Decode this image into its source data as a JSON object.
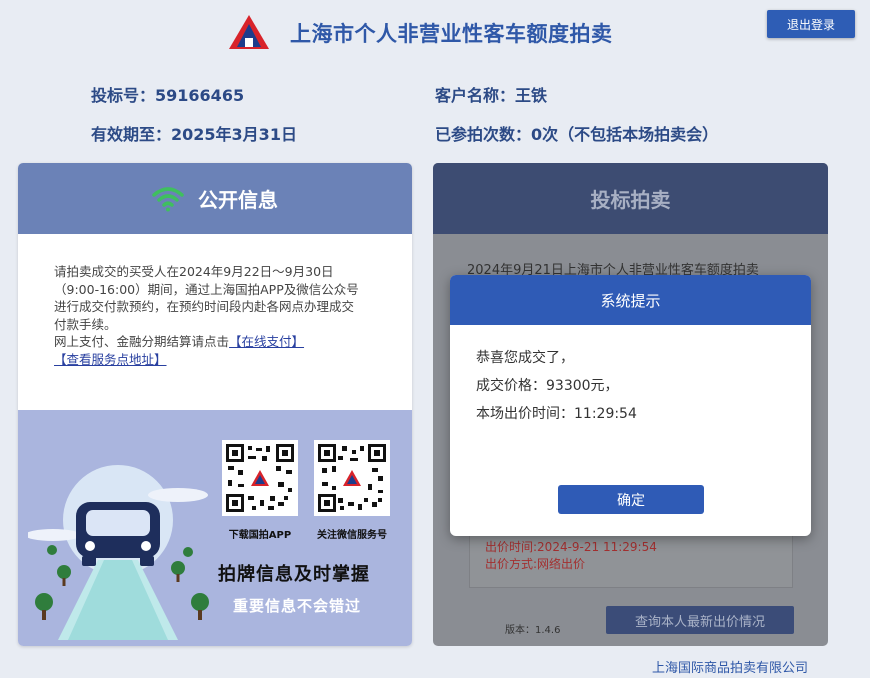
{
  "header": {
    "title": "上海市个人非营业性客车额度拍卖",
    "logout_label": "退出登录",
    "logo_icon": "auction-logo-triangle"
  },
  "user_info": {
    "bid_number_label": "投标号：",
    "bid_number": "59166465",
    "customer_name_label": "客户名称：",
    "customer_name": "王铁",
    "valid_until_label": "有效期至：",
    "valid_until": "2025年3月31日",
    "participated_label": "已参拍次数：",
    "participated": "0次（不包括本场拍卖会）"
  },
  "public_info": {
    "title": "公开信息",
    "icon": "wifi-icon",
    "notice_lines": [
      "请拍卖成交的买受人在2024年9月22日～9月30日",
      "（9:00-16:00）期间，通过上海国拍APP及微信公众号",
      "进行成交付款预约，在预约时间段内赴各网点办理成交",
      "付款手续。"
    ],
    "online_pay_prefix": "网上支付、金融分期结算请点击",
    "online_pay_link": "【在线支付】",
    "service_link": "【查看服务点地址】",
    "qr_app_caption": "下载国拍APP",
    "qr_wechat_caption": "关注微信服务号",
    "promo_line1": "拍牌信息及时掌握",
    "promo_line2": "重要信息不会错过"
  },
  "bidding": {
    "title": "投标拍卖",
    "subtitle": "2024年9月21日上海市个人非营业性客车额度拍卖",
    "bid_time": "出价时间:2024-9-21 11:29:54",
    "bid_method": "出价方式:网络出价",
    "version": "版本：1.4.6",
    "query_label": "查询本人最新出价情况"
  },
  "modal": {
    "title": "系统提示",
    "line1": "恭喜您成交了，",
    "line2": "成交价格：93300元，",
    "line3": "本场出价时间：11:29:54",
    "confirm_label": "确定"
  },
  "footer": {
    "company": "上海国际商品拍卖有限公司"
  },
  "colors": {
    "brand_blue": "#2f5bb6",
    "title_blue": "#2f58a8",
    "logo_red": "#d8232a"
  }
}
